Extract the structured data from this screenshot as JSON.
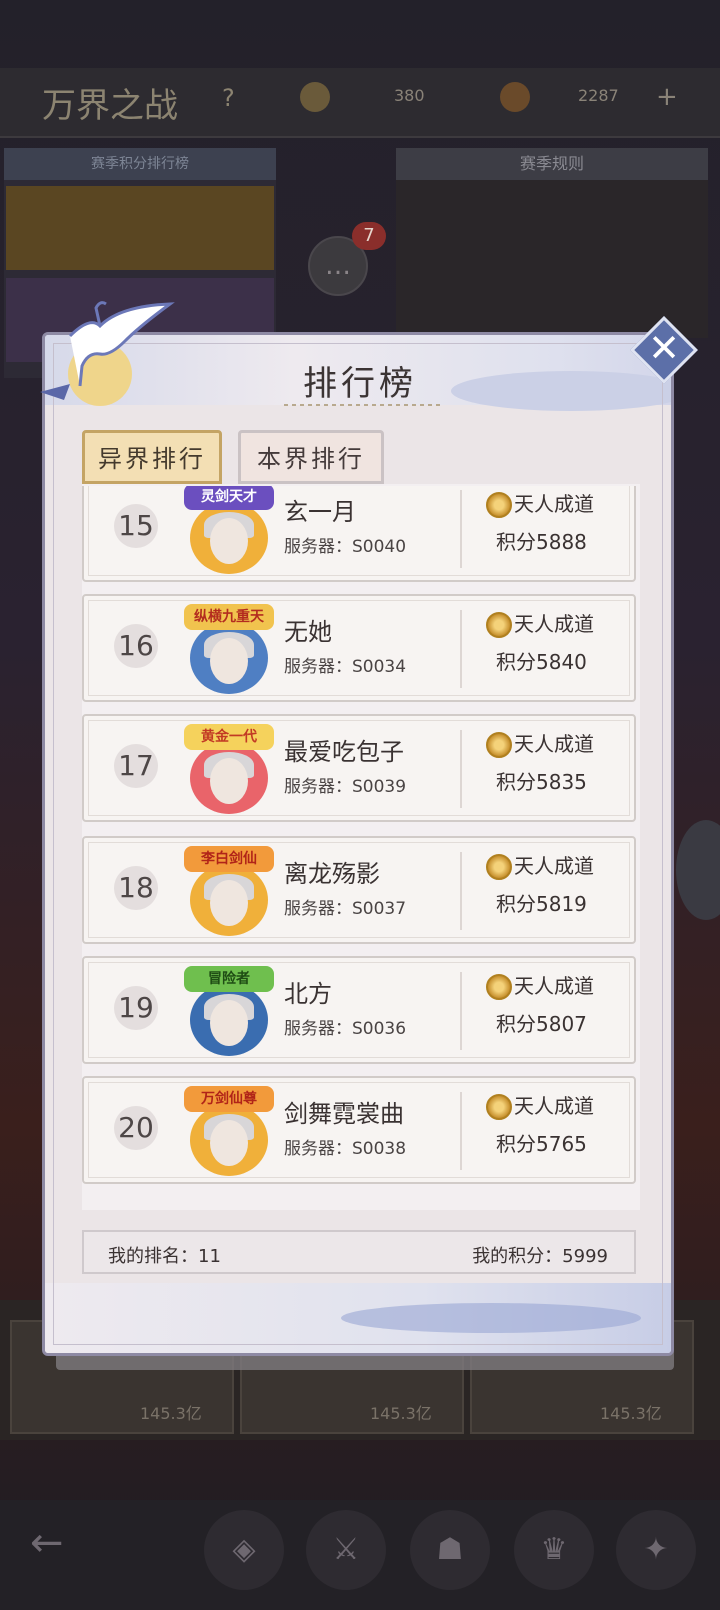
{
  "background": {
    "title": "万界之战",
    "help_icon": "question-icon",
    "resource1": "380",
    "resource2": "2287",
    "chat_badge": "7",
    "left_panel_title": "赛季积分排行榜",
    "right_panel_title": "赛季规则",
    "bottom_card_value": "145.3亿",
    "nav_back": "back-arrow-icon"
  },
  "dialog": {
    "title": "排行榜",
    "close_icon": "close-icon",
    "tabs": [
      {
        "label": "异界排行",
        "active": true
      },
      {
        "label": "本界排行",
        "active": false
      }
    ],
    "entries": [
      {
        "rank": "15",
        "title": "灵剑天才",
        "name": "玄一月",
        "server": "服务器：S0040",
        "realm": "天人成道",
        "score": "积分5888",
        "banner_bg": "#6b4fbf",
        "banner_fg": "#ffffff",
        "ring": "#f0b03a"
      },
      {
        "rank": "16",
        "title": "纵横九重天",
        "name": "无她",
        "server": "服务器：S0034",
        "realm": "天人成道",
        "score": "积分5840",
        "banner_bg": "#f1c34e",
        "banner_fg": "#b32c1f",
        "ring": "#4f7fc3"
      },
      {
        "rank": "17",
        "title": "黄金一代",
        "name": "最爱吃包子",
        "server": "服务器：S0039",
        "realm": "天人成道",
        "score": "积分5835",
        "banner_bg": "#f5d25c",
        "banner_fg": "#c23a24",
        "ring": "#e9646a"
      },
      {
        "rank": "18",
        "title": "李白剑仙",
        "name": "离龙殇影",
        "server": "服务器：S0037",
        "realm": "天人成道",
        "score": "积分5819",
        "banner_bg": "#f29a3b",
        "banner_fg": "#b12418",
        "ring": "#f0b03a"
      },
      {
        "rank": "19",
        "title": "冒险者",
        "name": "北方",
        "server": "服务器：S0036",
        "realm": "天人成道",
        "score": "积分5807",
        "banner_bg": "#6fbf4e",
        "banner_fg": "#1f4d14",
        "ring": "#3a6db0"
      },
      {
        "rank": "20",
        "title": "万剑仙尊",
        "name": "剑舞霓裳曲",
        "server": "服务器：S0038",
        "realm": "天人成道",
        "score": "积分5765",
        "banner_bg": "#f29a3b",
        "banner_fg": "#b12418",
        "ring": "#f0b03a"
      }
    ],
    "footer": {
      "my_rank": "我的排名：11",
      "my_score": "我的积分：5999"
    }
  }
}
